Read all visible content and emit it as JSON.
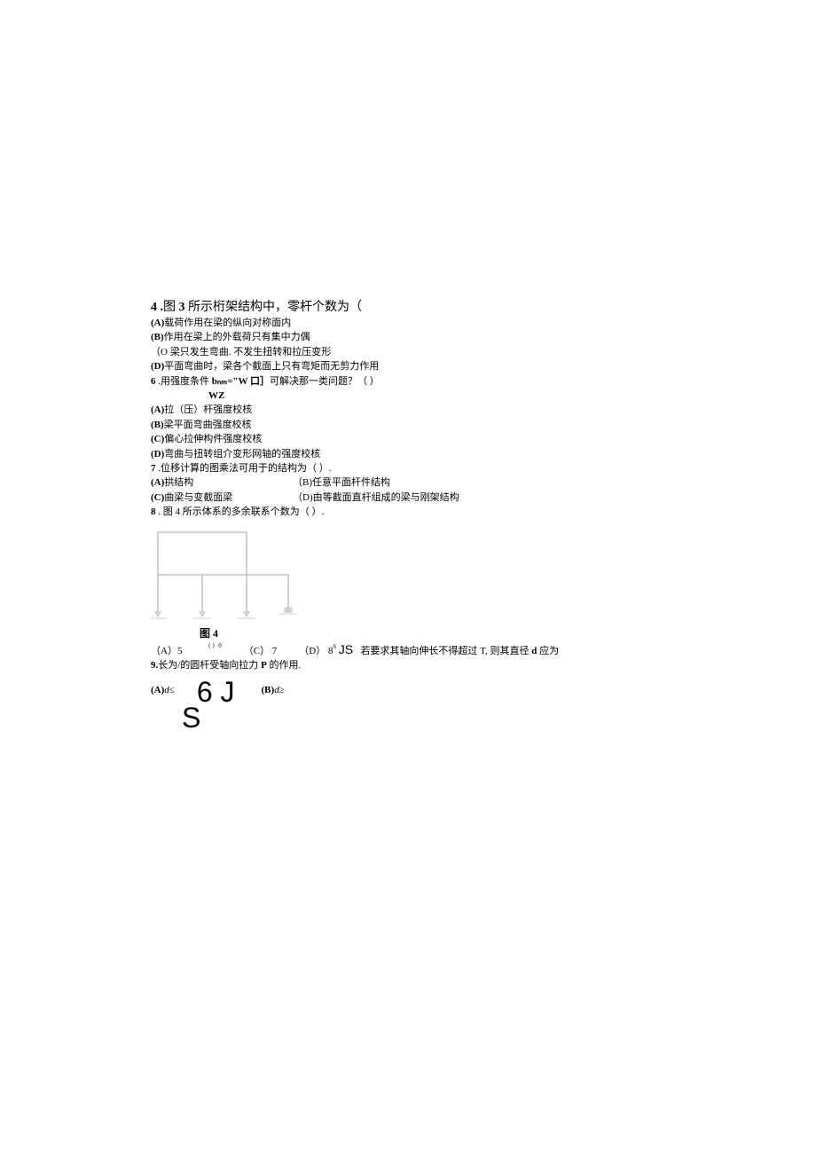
{
  "q4": {
    "number": "4 .",
    "title_pre": "图 ",
    "title_num": "3",
    "title_post": " 所示桁架结构中，零杆个数为（",
    "optA_label": "(A)",
    "optA_text": "载荷作用在梁的纵向对称面内",
    "optB_label": "(B)",
    "optB_text": "作用在梁上的外载荷只有集中力偶",
    "optC_label": "（O ",
    "optC_text": "梁只发生弯曲. 不发生扭转和拉压变形",
    "optD_label": "(D)",
    "optD_text": "平面弯曲时，梁各个截面上只有弯矩而无剪力作用"
  },
  "q6": {
    "number": "6",
    "text_pre": "    .用强度条件 ",
    "formula": "bₙₘ=\"W 口］",
    "text_post": "可解决那一类问题？（                ）",
    "sub_line": "WZ",
    "optA_label": "(A)",
    "optA_text": "拉（压）杆强度校核",
    "optB_label": "(B)",
    "optB_text": "梁平面弯曲强度校核",
    "optC_label": "(C)",
    "optC_text": "偏心拉伸构件强度校核",
    "optD_label": "(D)",
    "optD_text": "弯曲与扭转组介变形网轴的强度校核"
  },
  "q7": {
    "number": "7",
    "text": "    .位移计算的图乘法可用于的结构为（        ）.",
    "optA_label": "(A)",
    "optA_text": "拱结构",
    "optB_label": "（B)",
    "optB_text": "任意平面杆件结构",
    "optC_label": "(C)",
    "optC_text": "曲梁与变截面梁",
    "optD_label": "（D)",
    "optD_text": "由等截面直杆组成的梁与刚架结构"
  },
  "q8": {
    "number": "8",
    "text": "    . 图 4 所示体系的多余联系个数为（         ）.",
    "fig_label": "图 4",
    "optA": "（A）5",
    "optB_paren": "（    ）",
    "optB_sup": "0",
    "optC": "（C）   7",
    "optD": "（D）  8",
    "optD_sup": "6",
    "js": "JS",
    "tail": "若要求其轴向伸长不得超过 T, 则其直径 ",
    "tail_d": "d",
    "tail_end": " 应为"
  },
  "q9": {
    "number": "9.",
    "text_pre": "长为/的圆杆受轴向拉力 ",
    "text_P": "P",
    "text_post": " 的作用.",
    "optA_label": "(A)",
    "optA_var": "d",
    "optA_op": "≤",
    "big1": "6 J",
    "optB_label": "(B)",
    "optB_var": "d",
    "optB_op": "≥",
    "big2": "S"
  }
}
